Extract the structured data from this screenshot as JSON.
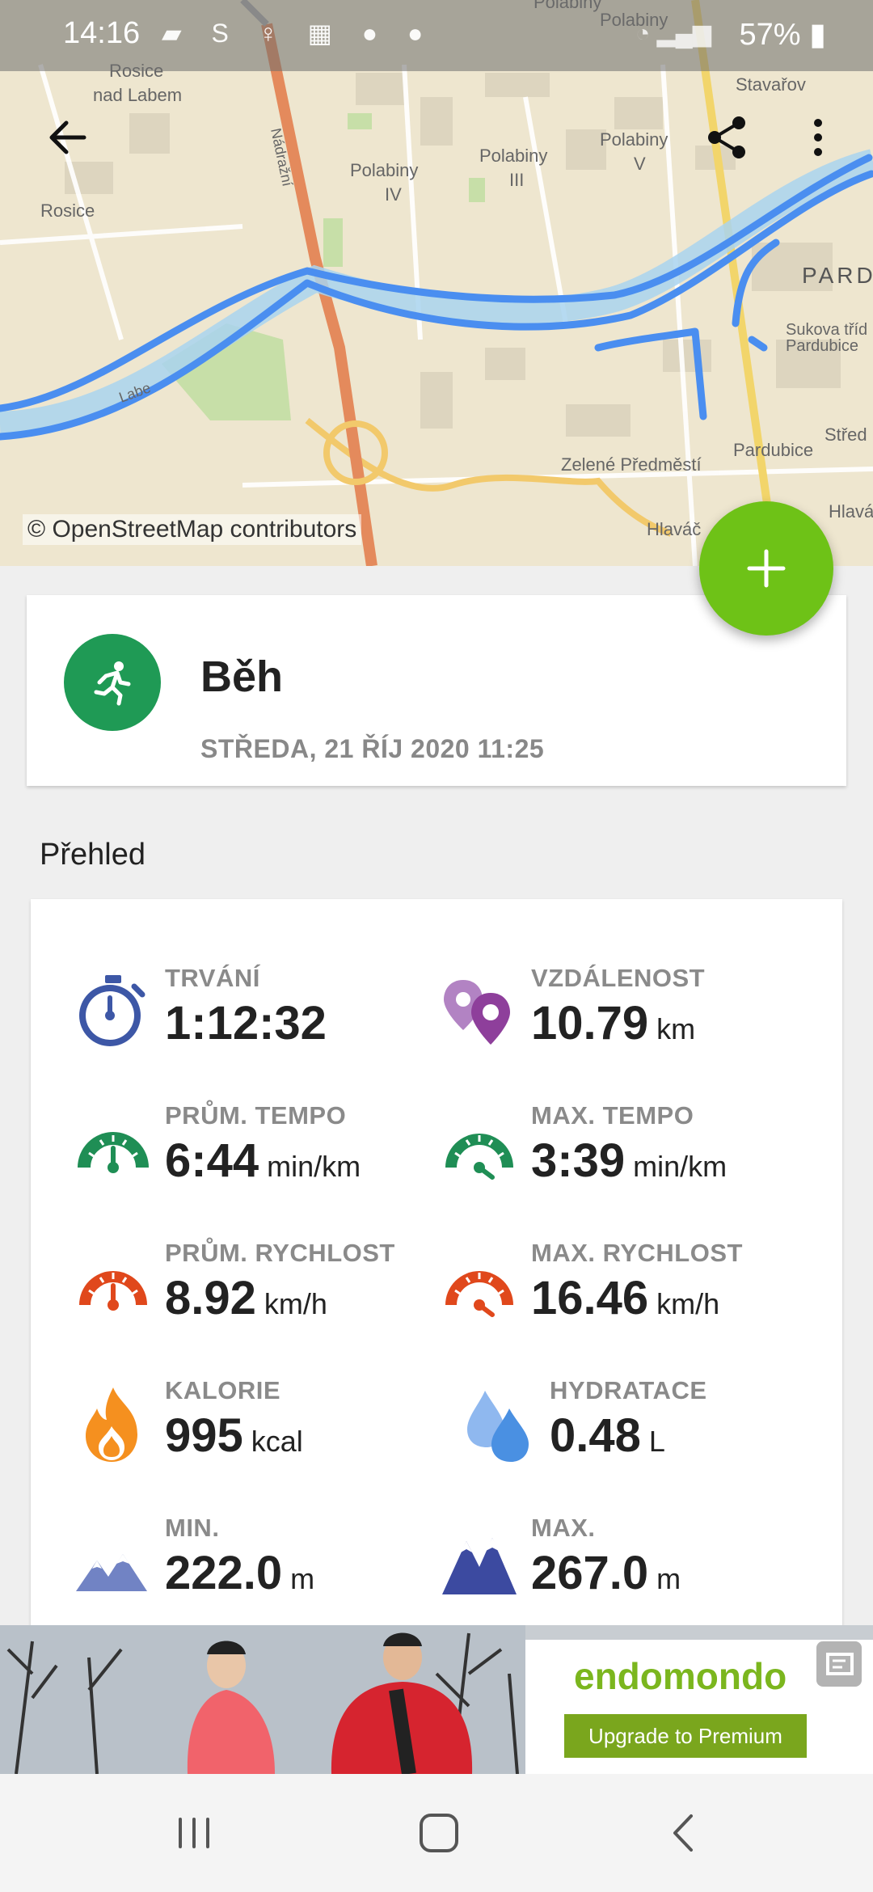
{
  "status_bar": {
    "time": "14:16",
    "battery": "57%"
  },
  "map": {
    "attribution": "© OpenStreetMap contributors",
    "places": [
      "Rosice nad Labem",
      "Rosice",
      "Polabiny IV",
      "Polabiny III",
      "Polabiny V",
      "Polabiny II",
      "Stavařov",
      "PARD",
      "Sukova tříd Pardubice",
      "Pardubice",
      "Střed",
      "Zelené Předměstí",
      "Hlaváč",
      "Hlavá",
      "Nádražní",
      "Labe"
    ],
    "route_color": "#4a8ef0"
  },
  "activity": {
    "title": "Běh",
    "date": "STŘEDA, 21 ŘÍJ 2020 11:25",
    "icon": "running-icon"
  },
  "overview": {
    "title": "Přehled",
    "stats": [
      {
        "label": "TRVÁNÍ",
        "value": "1:12:32",
        "unit": "",
        "icon": "stopwatch-icon"
      },
      {
        "label": "VZDÁLENOST",
        "value": "10.79",
        "unit": "km",
        "icon": "location-pins-icon"
      },
      {
        "label": "PRŮM. TEMPO",
        "value": "6:44",
        "unit": "min/km",
        "icon": "speedometer-green-icon"
      },
      {
        "label": "MAX. TEMPO",
        "value": "3:39",
        "unit": "min/km",
        "icon": "speedometer-green-max-icon"
      },
      {
        "label": "PRŮM. RYCHLOST",
        "value": "8.92",
        "unit": "km/h",
        "icon": "speedometer-red-icon"
      },
      {
        "label": "MAX. RYCHLOST",
        "value": "16.46",
        "unit": "km/h",
        "icon": "speedometer-red-max-icon"
      },
      {
        "label": "KALORIE",
        "value": "995",
        "unit": "kcal",
        "icon": "flame-icon"
      },
      {
        "label": "HYDRATACE",
        "value": "0.48",
        "unit": "L",
        "icon": "water-drops-icon"
      },
      {
        "label": "MIN.",
        "value": "222.0",
        "unit": "m",
        "icon": "mountains-min-icon"
      },
      {
        "label": "MAX.",
        "value": "267.0",
        "unit": "m",
        "icon": "mountains-max-icon"
      }
    ]
  },
  "ad": {
    "brand": "endomondo",
    "cta": "Upgrade to Premium"
  },
  "colors": {
    "accent_green": "#6ec217",
    "activity_green": "#1f9a55",
    "stopwatch_blue": "#3d57a6",
    "distance_purple": "#8e3f9b",
    "tempo_green": "#1f8e55",
    "speed_red": "#e0481c",
    "flame_orange": "#f5901f",
    "water_blue": "#4a90e2",
    "mountain_blue": "#3c4aa0"
  }
}
